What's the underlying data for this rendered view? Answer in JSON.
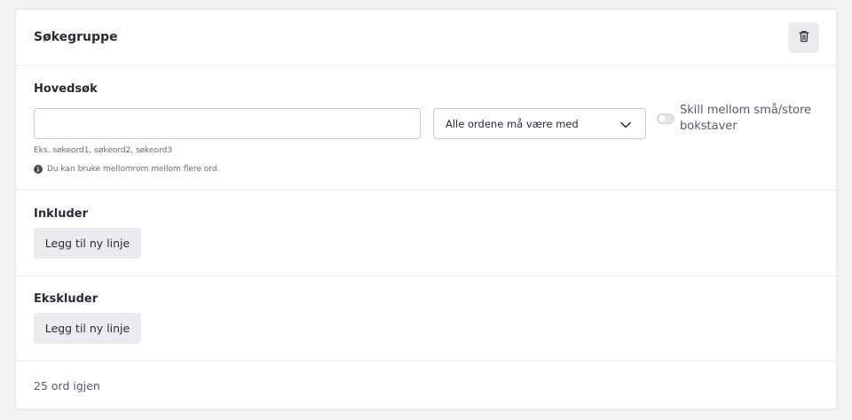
{
  "group": {
    "title": "Søkegruppe",
    "delete_icon": "trash-icon"
  },
  "main_search": {
    "label": "Hovedsøk",
    "input_value": "",
    "input_placeholder": "",
    "match_select": {
      "selected": "Alle ordene må være med"
    },
    "case_toggle": {
      "label": "Skill mellom små/store bokstaver",
      "on": false
    },
    "hint": "Eks. søkeord1, søkeord2, søkeord3",
    "info": "Du kan bruke mellomrom mellom flere ord."
  },
  "include": {
    "label": "Inkluder",
    "add_button": "Legg til ny linje"
  },
  "exclude": {
    "label": "Ekskluder",
    "add_button": "Legg til ny linje"
  },
  "footer": {
    "remaining": "25 ord igjen"
  },
  "colors": {
    "background": "#f2f2f4",
    "card": "#ffffff",
    "button_bg": "#ebebef",
    "text": "#2b2b38",
    "muted": "#5a5a66",
    "border": "#c9c9d0"
  }
}
